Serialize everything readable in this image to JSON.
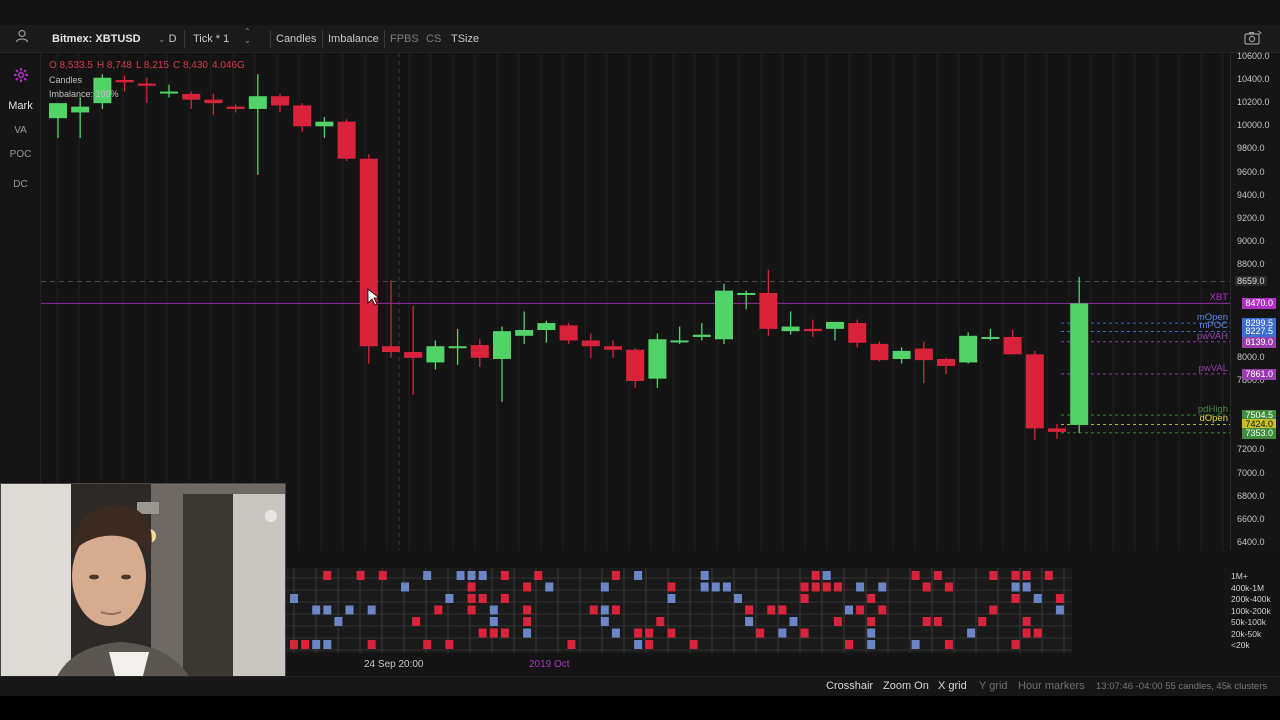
{
  "toolbar": {
    "symbol": "Bitmex: XBTUSD",
    "timeframe": "D",
    "tick": "Tick * 1",
    "candles": "Candles",
    "imbalance": "Imbalance",
    "fpbs": "FPBS",
    "cs": "CS",
    "tsize": "TSize"
  },
  "sidebar": {
    "mark": "Mark",
    "va": "VA",
    "poc": "POC",
    "dc": "DC"
  },
  "ohlc": {
    "o": "O 8,533.5",
    "h": "H 8,748",
    "l": "L 8,215",
    "c": "C 8,430",
    "v": "4.046G"
  },
  "legend": {
    "candles": "Candles",
    "imbalance": "Imbalance: 100%"
  },
  "crosshair_price": "8659.0",
  "price_axis": [
    {
      "value": 10600,
      "label": "10600.0"
    },
    {
      "value": 10400,
      "label": "10400.0"
    },
    {
      "value": 10200,
      "label": "10200.0"
    },
    {
      "value": 10000,
      "label": "10000.0"
    },
    {
      "value": 9800,
      "label": "9800.0"
    },
    {
      "value": 9600,
      "label": "9600.0"
    },
    {
      "value": 9400,
      "label": "9400.0"
    },
    {
      "value": 9200,
      "label": "9200.0"
    },
    {
      "value": 9000,
      "label": "9000.0"
    },
    {
      "value": 8800,
      "label": "8800.0"
    },
    {
      "value": 8000,
      "label": "8000.0"
    },
    {
      "value": 7800,
      "label": "7800.0"
    },
    {
      "value": 7200,
      "label": "7200.0"
    },
    {
      "value": 7000,
      "label": "7000.0"
    },
    {
      "value": 6800,
      "label": "6800.0"
    },
    {
      "value": 6600,
      "label": "6600.0"
    },
    {
      "value": 6400,
      "label": "6400.0"
    }
  ],
  "markers": [
    {
      "name": "XBT",
      "value": 8470,
      "label": "8470.0",
      "color": "#b030c8",
      "text_color": "#b030c8"
    },
    {
      "name": "mOpen",
      "value": 8299.5,
      "label": "8299.5",
      "color": "#3d6fd0",
      "text_color": "#5a86e0"
    },
    {
      "name": "mPOC",
      "value": 8227.5,
      "label": "8227.5",
      "color": "#3d6fd0",
      "text_color": "#5a86e0"
    },
    {
      "name": "pwVAH",
      "value": 8139,
      "label": "8139.0",
      "color": "#9a3cb0",
      "text_color": "#9a3cb0"
    },
    {
      "name": "pwVAL",
      "value": 7861,
      "label": "7861.0",
      "color": "#9a3cb0",
      "text_color": "#9a3cb0"
    },
    {
      "name": "pdHigh",
      "value": 7504.5,
      "label": "7504.5",
      "color": "#3e8d3a",
      "text_color": "#3e8d3a"
    },
    {
      "name": "dOpen",
      "value": 7424,
      "label": "7424.0",
      "color": "#c8c020",
      "text_color": "#e0d830"
    },
    {
      "name": "",
      "value": 7353,
      "label": "7353.0",
      "color": "#3e8d3a",
      "text_color": "#3e8d3a"
    }
  ],
  "candles": [
    {
      "o": 10070,
      "h": 10180,
      "l": 9900,
      "c": 10200
    },
    {
      "o": 10120,
      "h": 10250,
      "l": 9900,
      "c": 10170
    },
    {
      "o": 10200,
      "h": 10450,
      "l": 10150,
      "c": 10420
    },
    {
      "o": 10400,
      "h": 10440,
      "l": 10300,
      "c": 10380
    },
    {
      "o": 10370,
      "h": 10420,
      "l": 10200,
      "c": 10350
    },
    {
      "o": 10300,
      "h": 10360,
      "l": 10250,
      "c": 10300
    },
    {
      "o": 10280,
      "h": 10300,
      "l": 10150,
      "c": 10230
    },
    {
      "o": 10230,
      "h": 10280,
      "l": 10100,
      "c": 10200
    },
    {
      "o": 10170,
      "h": 10190,
      "l": 10120,
      "c": 10150
    },
    {
      "o": 10150,
      "h": 10450,
      "l": 9580,
      "c": 10260
    },
    {
      "o": 10260,
      "h": 10280,
      "l": 10120,
      "c": 10180
    },
    {
      "o": 10180,
      "h": 10200,
      "l": 9950,
      "c": 10000
    },
    {
      "o": 10000,
      "h": 10080,
      "l": 9900,
      "c": 10040
    },
    {
      "o": 10040,
      "h": 10060,
      "l": 9700,
      "c": 9720
    },
    {
      "o": 9720,
      "h": 9760,
      "l": 7950,
      "c": 8100
    },
    {
      "o": 8100,
      "h": 8670,
      "l": 8000,
      "c": 8050
    },
    {
      "o": 8050,
      "h": 8450,
      "l": 7680,
      "c": 8000
    },
    {
      "o": 7960,
      "h": 8150,
      "l": 7900,
      "c": 8100
    },
    {
      "o": 8100,
      "h": 8250,
      "l": 7940,
      "c": 8100
    },
    {
      "o": 8110,
      "h": 8160,
      "l": 7920,
      "c": 8000
    },
    {
      "o": 7990,
      "h": 8270,
      "l": 7620,
      "c": 8230
    },
    {
      "o": 8190,
      "h": 8400,
      "l": 8120,
      "c": 8240
    },
    {
      "o": 8240,
      "h": 8320,
      "l": 8130,
      "c": 8300
    },
    {
      "o": 8280,
      "h": 8300,
      "l": 8120,
      "c": 8150
    },
    {
      "o": 8150,
      "h": 8210,
      "l": 8000,
      "c": 8100
    },
    {
      "o": 8100,
      "h": 8150,
      "l": 8000,
      "c": 8070
    },
    {
      "o": 8070,
      "h": 8080,
      "l": 7740,
      "c": 7800
    },
    {
      "o": 7820,
      "h": 8210,
      "l": 7740,
      "c": 8160
    },
    {
      "o": 8150,
      "h": 8270,
      "l": 8120,
      "c": 8150
    },
    {
      "o": 8180,
      "h": 8300,
      "l": 8150,
      "c": 8200
    },
    {
      "o": 8160,
      "h": 8640,
      "l": 8120,
      "c": 8580
    },
    {
      "o": 8550,
      "h": 8580,
      "l": 8420,
      "c": 8560
    },
    {
      "o": 8560,
      "h": 8760,
      "l": 8190,
      "c": 8250
    },
    {
      "o": 8230,
      "h": 8400,
      "l": 8200,
      "c": 8270
    },
    {
      "o": 8250,
      "h": 8330,
      "l": 8180,
      "c": 8230
    },
    {
      "o": 8250,
      "h": 8300,
      "l": 8150,
      "c": 8310
    },
    {
      "o": 8300,
      "h": 8330,
      "l": 8090,
      "c": 8130
    },
    {
      "o": 8120,
      "h": 8140,
      "l": 7970,
      "c": 7980
    },
    {
      "o": 7990,
      "h": 8090,
      "l": 7950,
      "c": 8060
    },
    {
      "o": 8080,
      "h": 8140,
      "l": 7780,
      "c": 7980
    },
    {
      "o": 7990,
      "h": 8000,
      "l": 7860,
      "c": 7930
    },
    {
      "o": 7960,
      "h": 8220,
      "l": 7950,
      "c": 8190
    },
    {
      "o": 8180,
      "h": 8250,
      "l": 8150,
      "c": 8180
    },
    {
      "o": 8180,
      "h": 8240,
      "l": 8030,
      "c": 8030
    },
    {
      "o": 8030,
      "h": 8060,
      "l": 7290,
      "c": 7390
    },
    {
      "o": 7390,
      "h": 7430,
      "l": 7300,
      "c": 7360
    },
    {
      "o": 7420,
      "h": 8700,
      "l": 7350,
      "c": 8470
    }
  ],
  "x_axis": {
    "date": "24 Sep 20:00",
    "month": "2019 Oct"
  },
  "cluster_legend": [
    "1M+",
    "400k-1M",
    "200k-400k",
    "100k-200k",
    "50k-100k",
    "20k-50k",
    "<20k"
  ],
  "status": {
    "crosshair": "Crosshair",
    "zoom": "Zoom On",
    "xgrid": "X grid",
    "ygrid": "Y grid",
    "hour_markers": "Hour markers",
    "info": "13:07:46 -04:00 55 candles, 45k clusters"
  },
  "colors": {
    "up": "#52d36a",
    "down": "#d9233a",
    "background": "#141414",
    "accent": "#b030c8"
  }
}
